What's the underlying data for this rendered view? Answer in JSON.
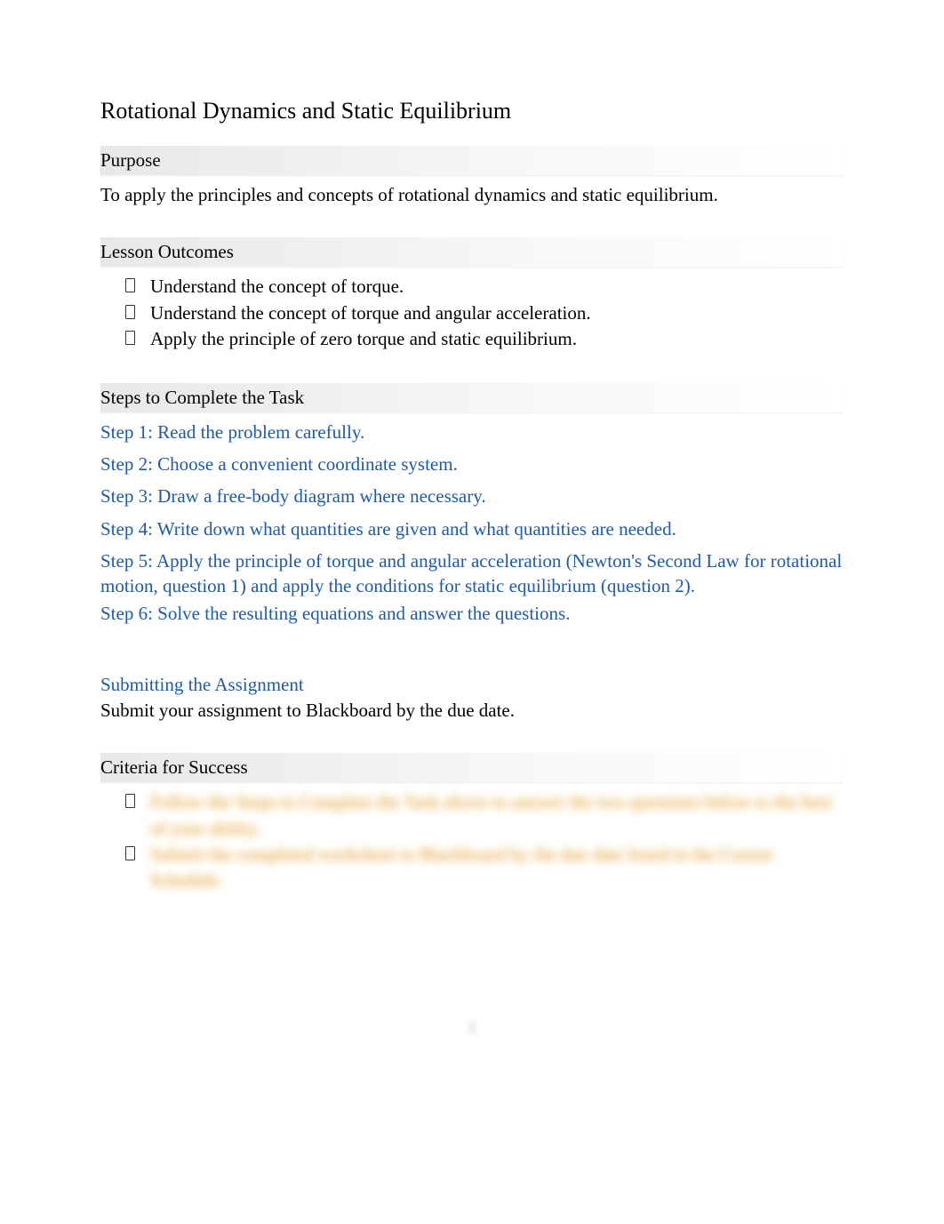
{
  "title": "Rotational Dynamics and Static Equilibrium",
  "sections": {
    "purpose": {
      "heading": "Purpose",
      "text": "To apply the principles and concepts of rotational dynamics and static equilibrium."
    },
    "outcomes": {
      "heading": "Lesson Outcomes",
      "items": [
        "Understand the concept of torque.",
        "Understand the concept of torque and angular acceleration.",
        "Apply the principle of zero torque and static equilibrium."
      ]
    },
    "steps": {
      "heading": "Steps to Complete the Task",
      "items": [
        "Step 1: Read the problem carefully.",
        "Step 2: Choose a convenient coordinate system.",
        "Step 3: Draw a free-body diagram where necessary.",
        "Step 4: Write down what quantities are given and what quantities are needed.",
        "Step 5: Apply the principle of torque and angular acceleration (Newton's Second Law for rotational motion, question 1) and apply the conditions for static equilibrium (question 2).",
        "Step 6: Solve the resulting equations and answer the questions."
      ]
    },
    "submitting": {
      "heading": "Submitting the Assignment",
      "text": "Submit your assignment to Blackboard by the due date."
    },
    "criteria": {
      "heading": "Criteria for Success",
      "items": [
        "Follow the Steps to Complete the Task above to answer the two questions below to the best of your ability.",
        "Submit the completed worksheet to Blackboard by the due date listed in the Course Schedule."
      ]
    }
  },
  "page_number": "1"
}
